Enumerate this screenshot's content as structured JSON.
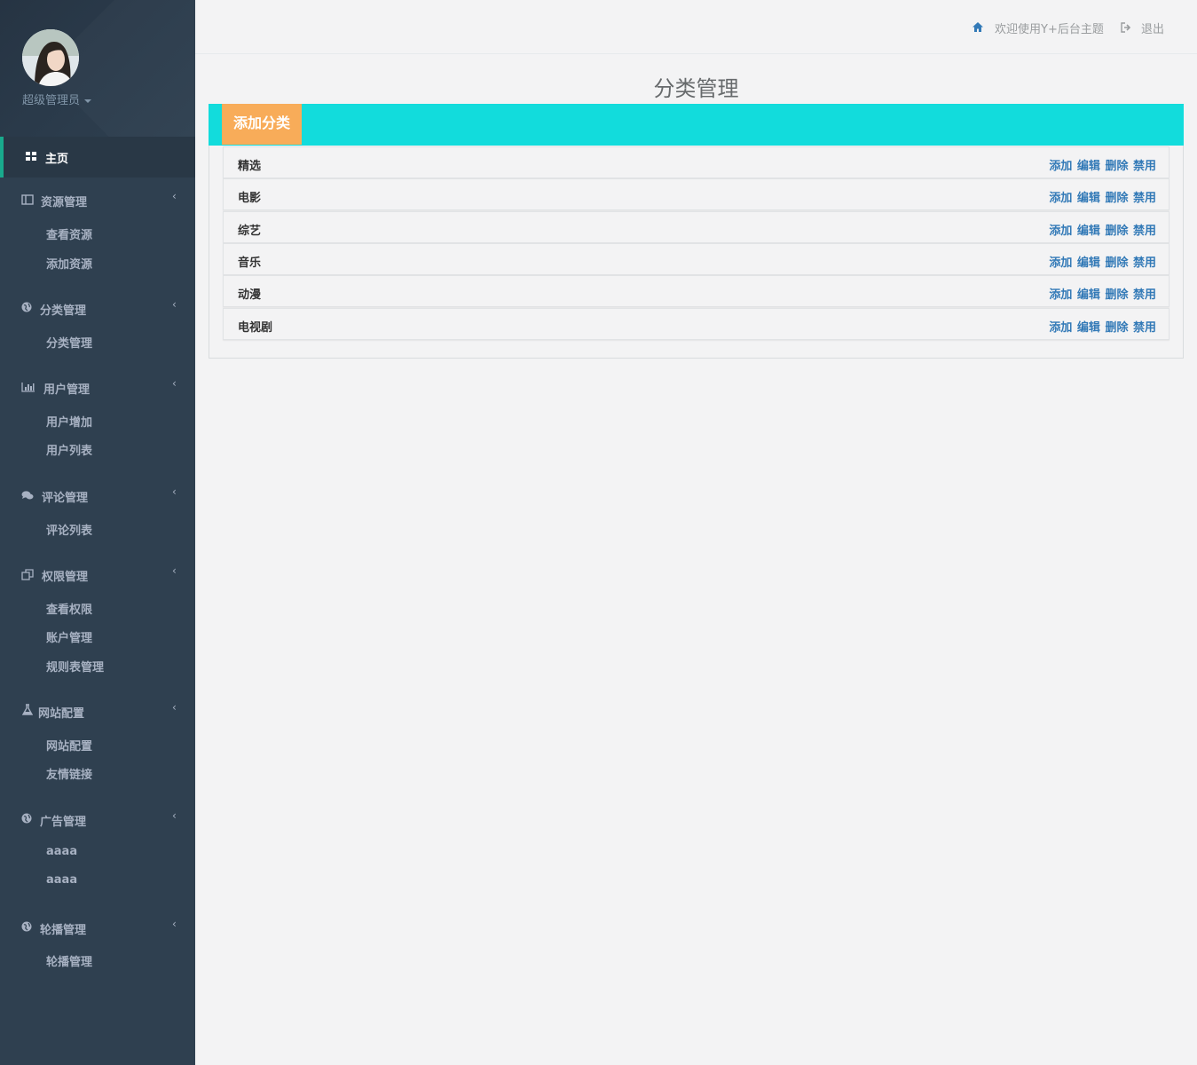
{
  "sidebar": {
    "admin_name": "超级管理员",
    "home": "主页",
    "groups": [
      {
        "label": "资源管理",
        "icon": "columns-icon",
        "items": [
          "查看资源",
          "添加资源"
        ]
      },
      {
        "label": "分类管理",
        "icon": "globe-icon",
        "items": [
          "分类管理"
        ]
      },
      {
        "label": "用户管理",
        "icon": "bar-chart-icon",
        "items": [
          "用户增加",
          "用户列表"
        ]
      },
      {
        "label": "评论管理",
        "icon": "comments-icon",
        "items": [
          "评论列表"
        ]
      },
      {
        "label": "权限管理",
        "icon": "copy-icon",
        "items": [
          "查看权限",
          "账户管理",
          "规则表管理"
        ]
      },
      {
        "label": "网站配置",
        "icon": "flask-icon",
        "items": [
          "网站配置",
          "友情链接"
        ]
      },
      {
        "label": "广告管理",
        "icon": "globe-icon",
        "items": [
          "aaaa",
          "aaaa"
        ]
      },
      {
        "label": "轮播管理",
        "icon": "globe-icon",
        "items": [
          "轮播管理"
        ]
      }
    ]
  },
  "header": {
    "welcome": "欢迎使用Y+后台主题",
    "logout": "退出"
  },
  "main": {
    "title": "分类管理",
    "add_button": "添加分类",
    "categories": [
      {
        "name": "精选"
      },
      {
        "name": "电影"
      },
      {
        "name": "综艺"
      },
      {
        "name": "音乐"
      },
      {
        "name": "动漫"
      },
      {
        "name": "电视剧"
      }
    ],
    "actions": {
      "add": "添加",
      "edit": "编辑",
      "delete": "删除",
      "disable": "禁用"
    }
  },
  "colors": {
    "sidebar_bg": "#2f4050",
    "active_border": "#19aa8d",
    "panel_header": "#12dcdc",
    "add_button": "#f8ac59",
    "link": "#337ab7"
  }
}
